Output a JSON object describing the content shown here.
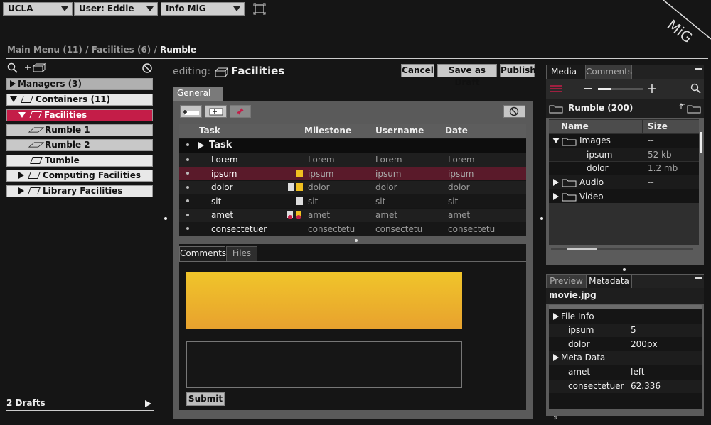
{
  "top": {
    "institution": "UCLA",
    "user": "User: Eddie",
    "info": "Info MiG",
    "logo": "MiG"
  },
  "breadcrumb": {
    "path": "Main Menu (11) / Facilities (6) / ",
    "current": "Rumble"
  },
  "tree": {
    "managers": "Managers (3)",
    "containers": "Containers (11)",
    "facilities": "Facilities",
    "rumble1": "Rumble 1",
    "rumble2": "Rumble 2",
    "tumble": "Tumble",
    "computing": "Computing Facilities",
    "library": "Library Facilities",
    "drafts": "2 Drafts"
  },
  "editor": {
    "editing_label": "editing:",
    "title": "Facilities",
    "cancel": "Cancel",
    "save_draft": "Save as Draft",
    "publish": "Publish",
    "tab_general": "General",
    "columns": [
      "Task",
      "Milestone",
      "Username",
      "Date"
    ],
    "group": "Task",
    "rows": [
      {
        "task": "Lorem",
        "milestone": "Lorem",
        "username": "Lorem",
        "date": "Lorem"
      },
      {
        "task": "ipsum",
        "milestone": "ipsum",
        "username": "ipsum",
        "date": "ipsum"
      },
      {
        "task": "dolor",
        "milestone": "dolor",
        "username": "dolor",
        "date": "dolor"
      },
      {
        "task": "sit",
        "milestone": "sit",
        "username": "sit",
        "date": "sit"
      },
      {
        "task": "amet",
        "milestone": "amet",
        "username": "amet",
        "date": "amet"
      },
      {
        "task": "consectetuer",
        "milestone": "consectetu",
        "username": "consectetu",
        "date": "consectetu"
      }
    ],
    "tab_comments": "Comments",
    "tab_files": "Files",
    "submit": "Submit"
  },
  "media": {
    "tab_media": "Media",
    "tab_comments": "Comments",
    "folder": "Rumble (200)",
    "col_name": "Name",
    "col_size": "Size",
    "items": [
      {
        "name": "Images",
        "size": "--"
      },
      {
        "name": "ipsum",
        "size": "52 kb"
      },
      {
        "name": "dolor",
        "size": "1.2 mb"
      },
      {
        "name": "Audio",
        "size": "--"
      },
      {
        "name": "Video",
        "size": "--"
      }
    ]
  },
  "meta": {
    "tab_preview": "Preview",
    "tab_metadata": "Metadata",
    "file": "movie.jpg",
    "file_info": "File Info",
    "rows1": [
      {
        "k": "ipsum",
        "v": "5"
      },
      {
        "k": "dolor",
        "v": "200px"
      }
    ],
    "meta_data": "Meta Data",
    "rows2": [
      {
        "k": "amet",
        "v": "left"
      },
      {
        "k": "consectetuer",
        "v": "62.336"
      }
    ],
    "footer": "»"
  },
  "colors": {
    "accent": "#c41d48",
    "highlight_row": "#5a1a2a",
    "yellow": "#f0c020"
  }
}
